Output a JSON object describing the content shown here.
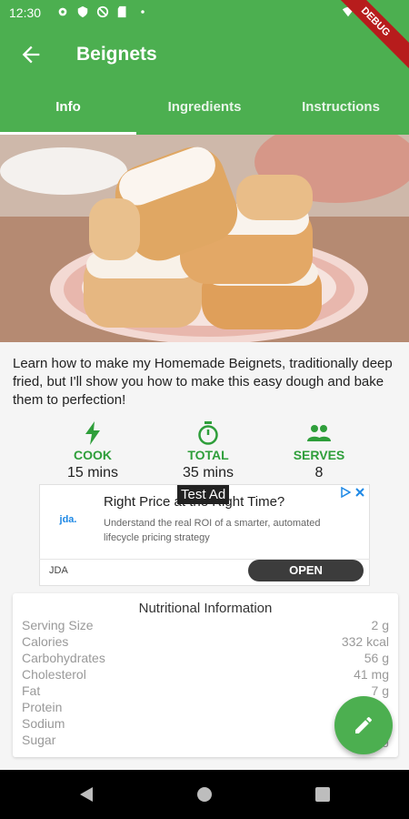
{
  "status_bar": {
    "time": "12:30",
    "debug_banner": "DEBUG"
  },
  "app_bar": {
    "title": "Beignets"
  },
  "tabs": [
    {
      "label": "Info",
      "active": true
    },
    {
      "label": "Ingredients",
      "active": false
    },
    {
      "label": "Instructions",
      "active": false
    }
  ],
  "description": "Learn how to make my Homemade Beignets, traditionally deep fried, but I'll show you how to make this easy dough and bake them to perfection!",
  "stats": [
    {
      "icon": "lightning-icon",
      "label": "COOK",
      "value": "15 mins"
    },
    {
      "icon": "timer-icon",
      "label": "TOTAL",
      "value": "35 mins"
    },
    {
      "icon": "people-icon",
      "label": "SERVES",
      "value": "8"
    }
  ],
  "ad": {
    "logo_text": "jda.",
    "headline": "Right Price at the Right Time?",
    "subtext": "Understand the real ROI of a smarter, automated lifecycle pricing strategy",
    "brand": "JDA",
    "cta": "OPEN",
    "test_label": "Test Ad"
  },
  "nutrition": {
    "title": "Nutritional Information",
    "rows": [
      {
        "label": "Serving Size",
        "value": "2 g"
      },
      {
        "label": "Calories",
        "value": "332 kcal"
      },
      {
        "label": "Carbohydrates",
        "value": "56 g"
      },
      {
        "label": "Cholesterol",
        "value": "41 mg"
      },
      {
        "label": "Fat",
        "value": "7 g"
      },
      {
        "label": "Protein",
        "value": ""
      },
      {
        "label": "Sodium",
        "value": ""
      },
      {
        "label": "Sugar",
        "value": "g"
      }
    ]
  },
  "colors": {
    "primary": "#4caf50",
    "accent_text": "#2e9e3a"
  }
}
